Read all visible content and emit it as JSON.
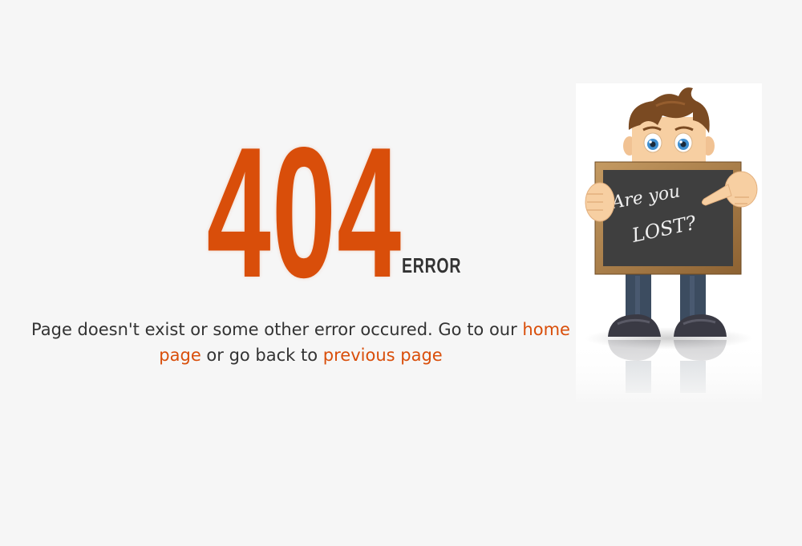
{
  "error": {
    "code": "404",
    "label": "ERROR"
  },
  "message": {
    "text_before": "Page doesn't exist or some other error occured. Go to our ",
    "home_link": "home page",
    "text_middle": " or go back to ",
    "previous_link": "previous page"
  },
  "illustration": {
    "chalkboard_line1": "Are you",
    "chalkboard_line2": "LOST?"
  },
  "colors": {
    "accent": "#d94e0a",
    "text": "#333333",
    "background": "#f6f6f6"
  }
}
